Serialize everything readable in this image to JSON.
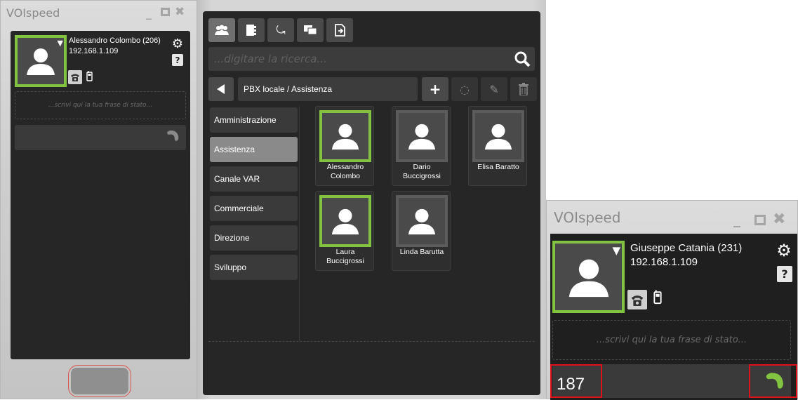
{
  "left_window": {
    "title": "VOIspeed",
    "user": {
      "name": "Alessandro Colombo (206)",
      "ip": "192.168.1.109"
    },
    "status_placeholder": "...scrivi qui la tua frase di stato..."
  },
  "directory": {
    "search_placeholder": "...digitare la ricerca...",
    "path": "PBX locale / Assistenza",
    "groups": [
      {
        "label": "Amministrazione"
      },
      {
        "label": "Assistenza"
      },
      {
        "label": "Canale VAR"
      },
      {
        "label": "Commerciale"
      },
      {
        "label": "Direzione"
      },
      {
        "label": "Sviluppo"
      }
    ],
    "contacts": [
      {
        "name": "Alessandro\nColombo",
        "online": true
      },
      {
        "name": "Dario\nBuccigrossi",
        "online": false
      },
      {
        "name": "Elisa Baratto",
        "online": false
      },
      {
        "name": "Laura\nBuccigrossi",
        "online": true
      },
      {
        "name": "Linda Barutta",
        "online": false
      }
    ]
  },
  "right_window": {
    "title": "VOIspeed",
    "user": {
      "name": "Giuseppe Catania (231)",
      "ip": "192.168.1.109"
    },
    "status_placeholder": "...scrivi qui la tua frase di stato...",
    "dial_value": "187"
  },
  "colors": {
    "online": "#82c341",
    "offline": "#5c5c5c",
    "highlight": "#e0101a"
  }
}
